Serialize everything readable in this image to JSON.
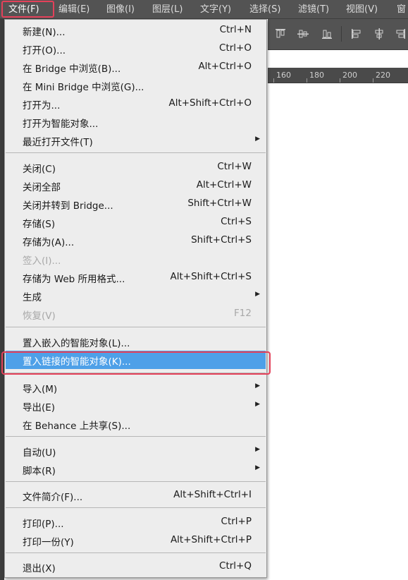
{
  "menubar": {
    "items": [
      {
        "label": "文件(F)"
      },
      {
        "label": "编辑(E)"
      },
      {
        "label": "图像(I)"
      },
      {
        "label": "图层(L)"
      },
      {
        "label": "文字(Y)"
      },
      {
        "label": "选择(S)"
      },
      {
        "label": "滤镜(T)"
      },
      {
        "label": "视图(V)"
      },
      {
        "label": "窗"
      }
    ]
  },
  "ruler": {
    "ticks": [
      "160",
      "180",
      "200",
      "220"
    ]
  },
  "file_menu": {
    "items": [
      {
        "label": "新建(N)...",
        "shortcut": "Ctrl+N"
      },
      {
        "label": "打开(O)...",
        "shortcut": "Ctrl+O"
      },
      {
        "label": "在 Bridge 中浏览(B)...",
        "shortcut": "Alt+Ctrl+O"
      },
      {
        "label": "在 Mini Bridge 中浏览(G)...",
        "shortcut": ""
      },
      {
        "label": "打开为...",
        "shortcut": "Alt+Shift+Ctrl+O"
      },
      {
        "label": "打开为智能对象...",
        "shortcut": ""
      },
      {
        "label": "最近打开文件(T)",
        "shortcut": "",
        "submenu": true
      },
      {
        "label": "关闭(C)",
        "shortcut": "Ctrl+W"
      },
      {
        "label": "关闭全部",
        "shortcut": "Alt+Ctrl+W"
      },
      {
        "label": "关闭并转到 Bridge...",
        "shortcut": "Shift+Ctrl+W"
      },
      {
        "label": "存储(S)",
        "shortcut": "Ctrl+S"
      },
      {
        "label": "存储为(A)...",
        "shortcut": "Shift+Ctrl+S"
      },
      {
        "label": "签入(I)...",
        "shortcut": "",
        "disabled": true
      },
      {
        "label": "存储为 Web 所用格式...",
        "shortcut": "Alt+Shift+Ctrl+S"
      },
      {
        "label": "生成",
        "shortcut": "",
        "submenu": true
      },
      {
        "label": "恢复(V)",
        "shortcut": "F12",
        "disabled": true
      },
      {
        "label": "置入嵌入的智能对象(L)...",
        "shortcut": ""
      },
      {
        "label": "置入链接的智能对象(K)...",
        "shortcut": "",
        "selected": true
      },
      {
        "label": "导入(M)",
        "shortcut": "",
        "submenu": true
      },
      {
        "label": "导出(E)",
        "shortcut": "",
        "submenu": true
      },
      {
        "label": "在 Behance 上共享(S)...",
        "shortcut": ""
      },
      {
        "label": "自动(U)",
        "shortcut": "",
        "submenu": true
      },
      {
        "label": "脚本(R)",
        "shortcut": "",
        "submenu": true
      },
      {
        "label": "文件简介(F)...",
        "shortcut": "Alt+Shift+Ctrl+I"
      },
      {
        "label": "打印(P)...",
        "shortcut": "Ctrl+P"
      },
      {
        "label": "打印一份(Y)",
        "shortcut": "Alt+Shift+Ctrl+P"
      },
      {
        "label": "退出(X)",
        "shortcut": "Ctrl+Q"
      }
    ]
  },
  "colors": {
    "highlight": "#e4415a",
    "selection": "#4ea0e8",
    "menubar": "#535353"
  }
}
